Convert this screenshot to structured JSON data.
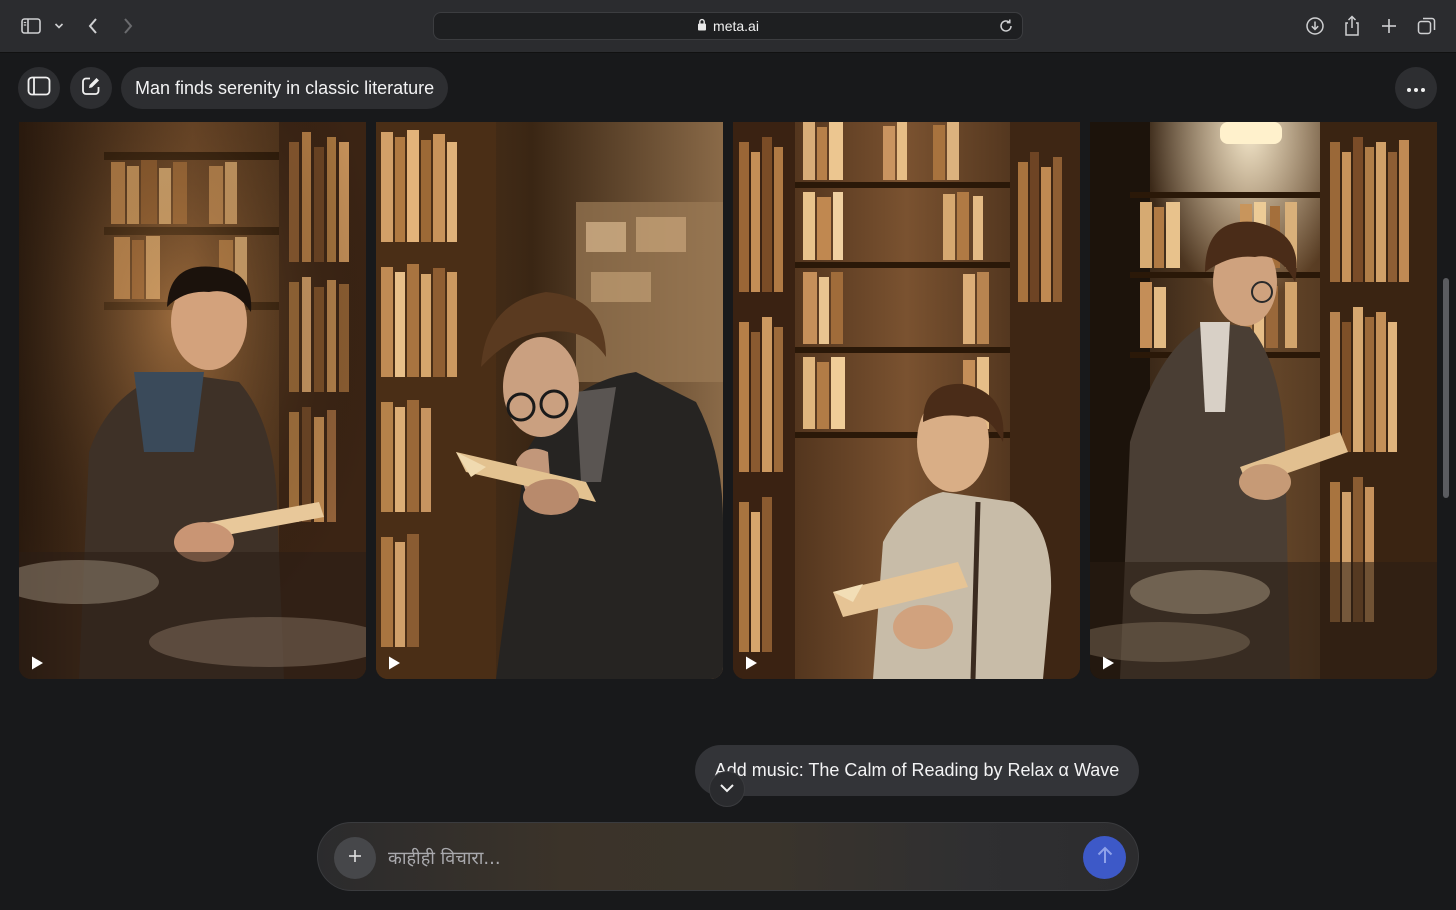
{
  "browser": {
    "url": "meta.ai"
  },
  "header": {
    "conversation_title": "Man finds serenity in classic literature"
  },
  "gallery": {
    "tiles": [
      {
        "id": 1
      },
      {
        "id": 2
      },
      {
        "id": 3
      },
      {
        "id": 4
      }
    ]
  },
  "music_suggestion": {
    "label": "Add music: The Calm of Reading by Relax α Wave"
  },
  "composer": {
    "placeholder": "काहीही विचारा..."
  },
  "colors": {
    "background": "#18191b",
    "pill": "#2d2e31",
    "send_button": "#3d59c8"
  }
}
